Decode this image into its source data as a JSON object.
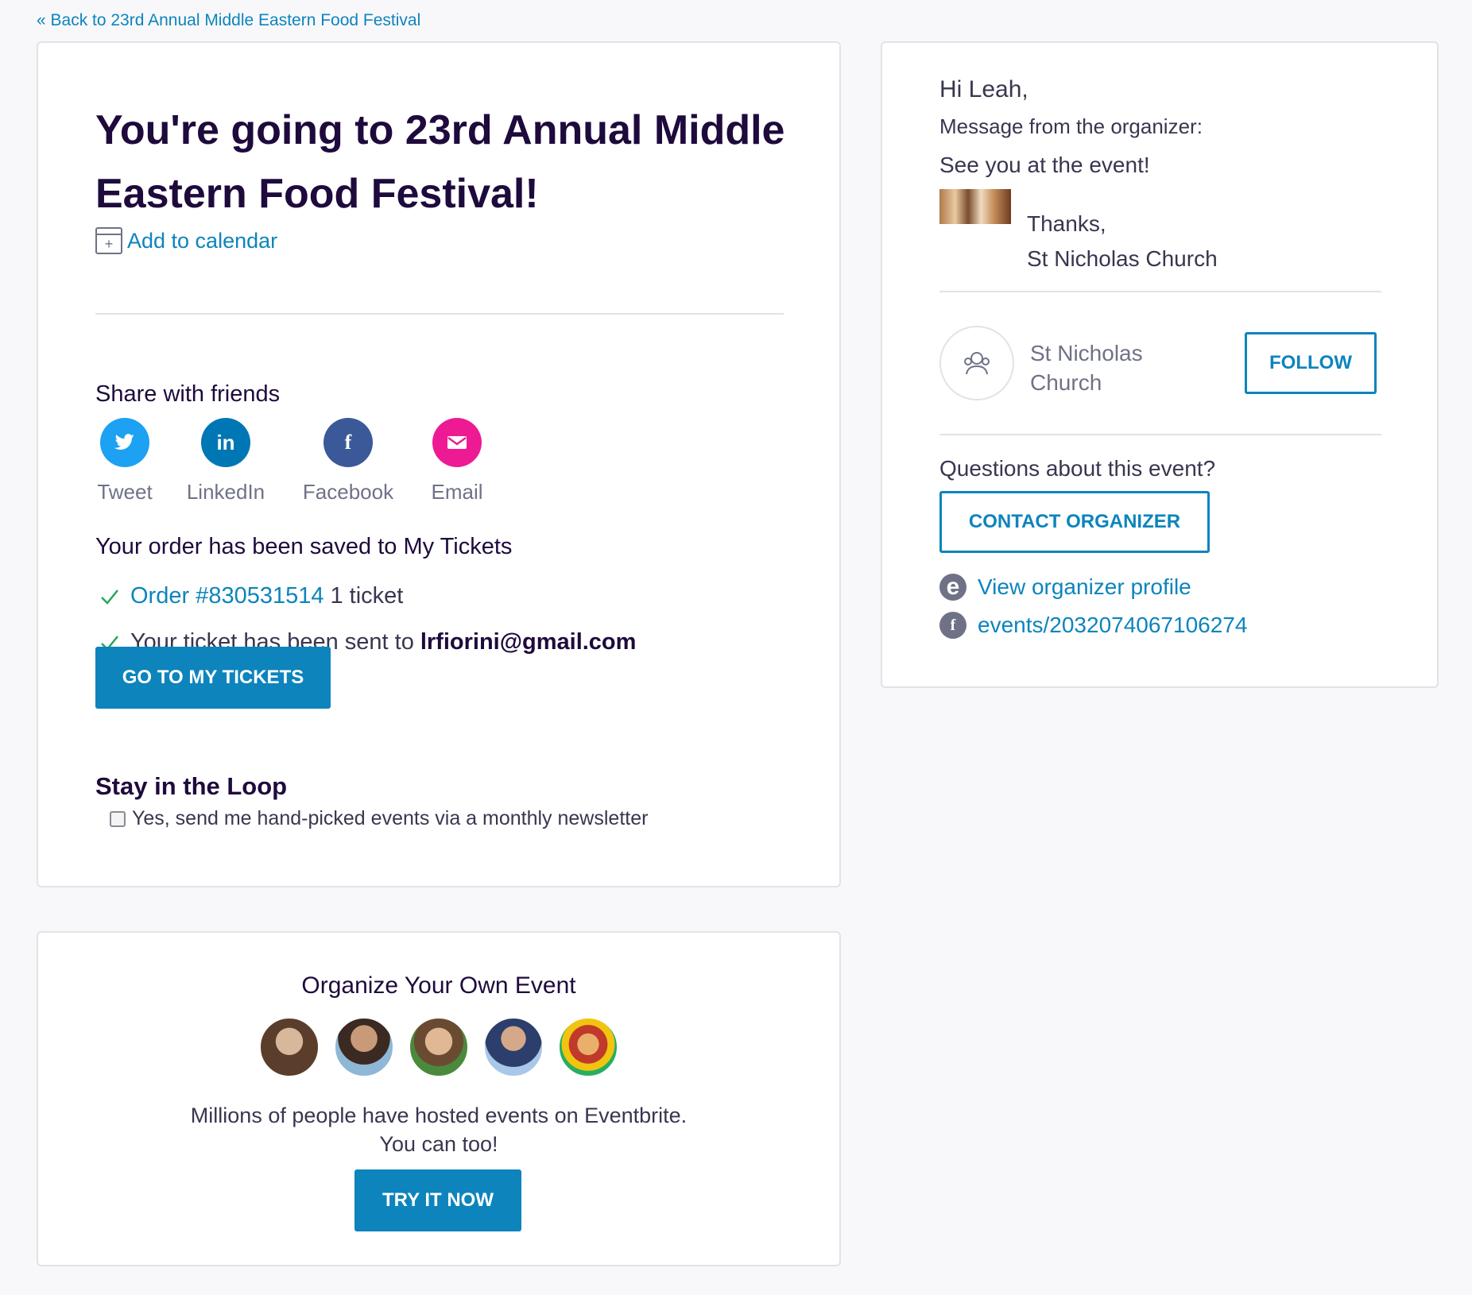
{
  "nav": {
    "back_label": "« Back to 23rd Annual Middle Eastern Food Festival"
  },
  "main": {
    "title": "You're going to 23rd Annual Middle Eastern Food Festival!",
    "add_to_calendar": "Add to calendar",
    "share_heading": "Share with friends",
    "share": [
      {
        "label": "Tweet",
        "icon": "twitter-icon",
        "color": "#1da1f2",
        "glyph": ""
      },
      {
        "label": "LinkedIn",
        "icon": "linkedin-icon",
        "color": "#0077b5",
        "glyph": "in"
      },
      {
        "label": "Facebook",
        "icon": "facebook-icon",
        "color": "#3b5998",
        "glyph": "f"
      },
      {
        "label": "Email",
        "icon": "email-icon",
        "color": "#ee1a94",
        "glyph": ""
      }
    ],
    "order_saved": "Your order has been saved to My Tickets",
    "order_link": "Order #830531514",
    "order_tickets": "1 ticket",
    "ticket_sent_prefix": "Your ticket has been sent to",
    "ticket_email": "lrfiorini@gmail.com",
    "go_to_tickets": "GO TO MY TICKETS",
    "loop_heading": "Stay in the Loop",
    "newsletter_label": "Yes, send me hand-picked events via a monthly newsletter"
  },
  "side": {
    "greeting": "Hi Leah,",
    "message_label": "Message from the organizer:",
    "message": "See you at the event!",
    "thanks": "Thanks,",
    "signature": "St Nicholas Church",
    "organizer_name": "St Nicholas Church",
    "follow": "FOLLOW",
    "questions": "Questions about this event?",
    "contact": "CONTACT ORGANIZER",
    "profile_link": "View organizer profile",
    "facebook_link": "events/2032074067106274"
  },
  "organize": {
    "heading": "Organize Your Own Event",
    "desc_line1": "Millions of people have hosted events on Eventbrite.",
    "desc_line2": "You can too!",
    "try_now": "TRY IT NOW"
  },
  "colors": {
    "accent": "#0d84bc",
    "heading": "#1e0a3c",
    "muted": "#6f7287"
  }
}
